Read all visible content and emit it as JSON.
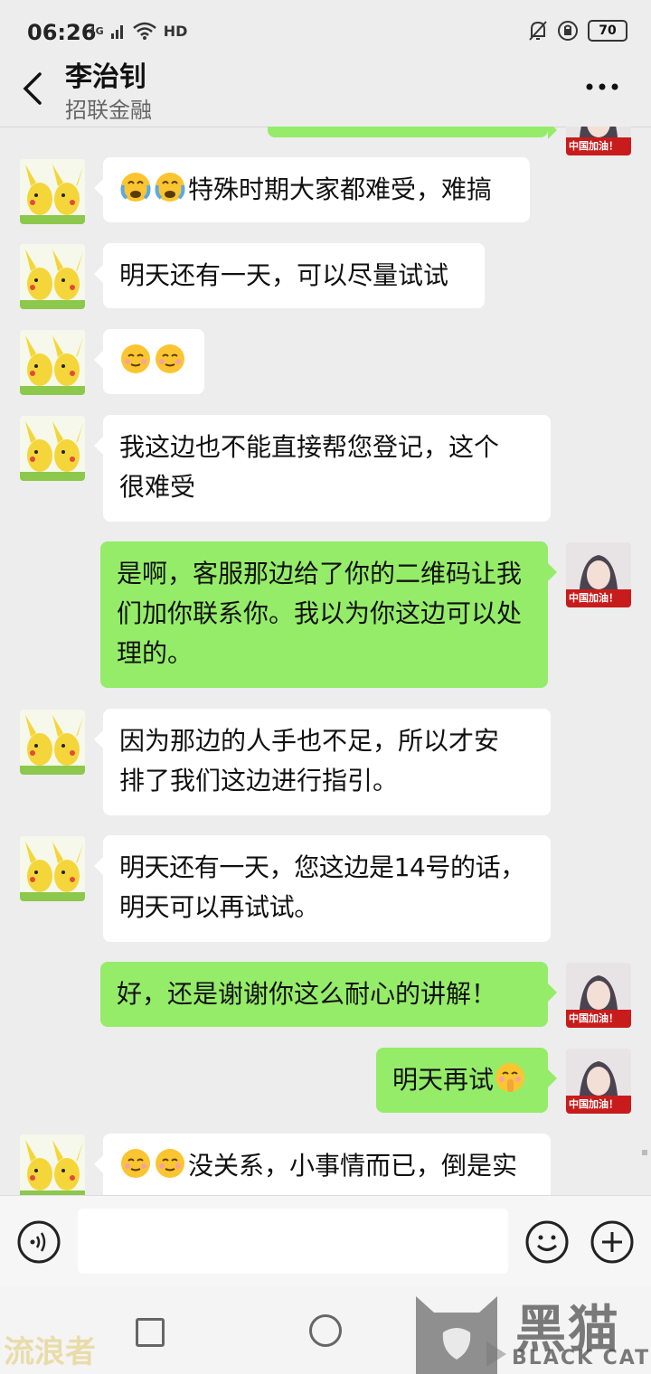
{
  "status_bar": {
    "time": "06:26",
    "network": "4G",
    "hd": "HD",
    "battery": "70"
  },
  "header": {
    "title": "李治钊",
    "subtitle": "招联金融"
  },
  "messages": [
    {
      "side": "right",
      "text": ""
    },
    {
      "side": "left",
      "text": "特殊时期大家都难受，难搞"
    },
    {
      "side": "left",
      "text": "明天还有一天，可以尽量试试"
    },
    {
      "side": "left",
      "text": ""
    },
    {
      "side": "left",
      "text_line1": "我这边也不能直接帮您登记，这个",
      "text_line2": "很难受"
    },
    {
      "side": "right",
      "text_line1": "是啊，客服那边给了你的二维码让我",
      "text_line2": "们加你联系你。我以为你这边可以处",
      "text_line3": "理的。"
    },
    {
      "side": "left",
      "text_line1": "因为那边的人手也不足，所以才安",
      "text_line2": "排了我们这边进行指引。"
    },
    {
      "side": "left",
      "text_line1": "明天还有一天，您这边是14号的话，",
      "text_line2": "明天可以再试试。"
    },
    {
      "side": "right",
      "text": "好，还是谢谢你这么耐心的讲解！"
    },
    {
      "side": "right",
      "text": "明天再试"
    },
    {
      "side": "left",
      "text": "没关系，小事情而已，倒是实"
    }
  ],
  "avatar_badge": "中国加油！",
  "watermark": {
    "left": "流浪者",
    "brand_cn": "黑猫",
    "brand_en": "BLACK CAT"
  },
  "colors": {
    "background": "#ededed",
    "bubble_mine": "#95ec69",
    "bubble_theirs": "#ffffff"
  }
}
